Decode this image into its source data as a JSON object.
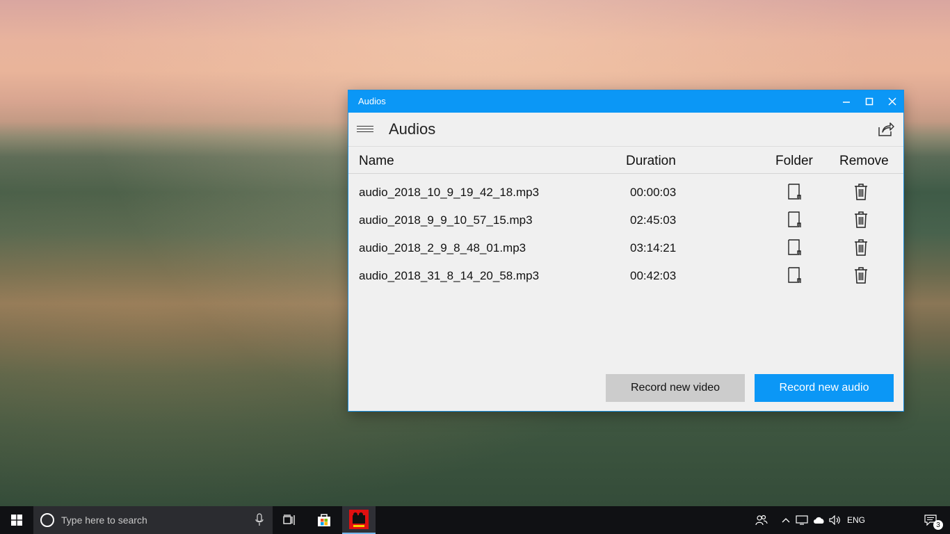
{
  "window": {
    "title": "Audios",
    "app_title": "Audios",
    "minimize_icon": "minimize-icon",
    "maximize_icon": "maximize-icon",
    "close_icon": "close-icon"
  },
  "columns": {
    "name": "Name",
    "duration": "Duration",
    "folder": "Folder",
    "remove": "Remove"
  },
  "audios": [
    {
      "name": "audio_2018_10_9_19_42_18.mp3",
      "duration": "00:00:03"
    },
    {
      "name": "audio_2018_9_9_10_57_15.mp3",
      "duration": "02:45:03"
    },
    {
      "name": "audio_2018_2_9_8_48_01.mp3",
      "duration": "03:14:21"
    },
    {
      "name": "audio_2018_31_8_14_20_58.mp3",
      "duration": "00:42:03"
    }
  ],
  "buttons": {
    "record_video": "Record new video",
    "record_audio": "Record new audio"
  },
  "taskbar": {
    "search_placeholder": "Type here to search",
    "language": "ENG",
    "notification_count": "3"
  },
  "colors": {
    "accent": "#0b97f6",
    "secondary_button": "#cccccc",
    "taskbar": "#101114"
  }
}
